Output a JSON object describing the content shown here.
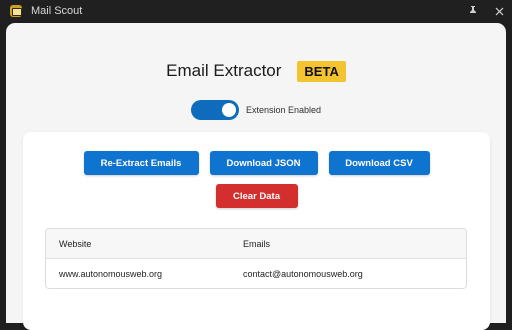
{
  "titlebar": {
    "app_title": "Mail Scout",
    "pin_icon": "pin-icon",
    "close_icon": "close-icon"
  },
  "header": {
    "title": "Email Extractor",
    "badge": "BETA"
  },
  "toggle": {
    "label": "Extension Enabled",
    "enabled": true
  },
  "actions": {
    "reextract_label": "Re-Extract Emails",
    "download_json_label": "Download JSON",
    "download_csv_label": "Download CSV",
    "clear_label": "Clear Data"
  },
  "table": {
    "columns": [
      "Website",
      "Emails"
    ],
    "rows": [
      {
        "website": "www.autonomousweb.org",
        "email": "contact@autonomousweb.org"
      }
    ]
  },
  "colors": {
    "primary": "#0f73d0",
    "danger": "#d32f2f",
    "badge": "#f4c430",
    "toggle_on": "#0f6cbd"
  }
}
